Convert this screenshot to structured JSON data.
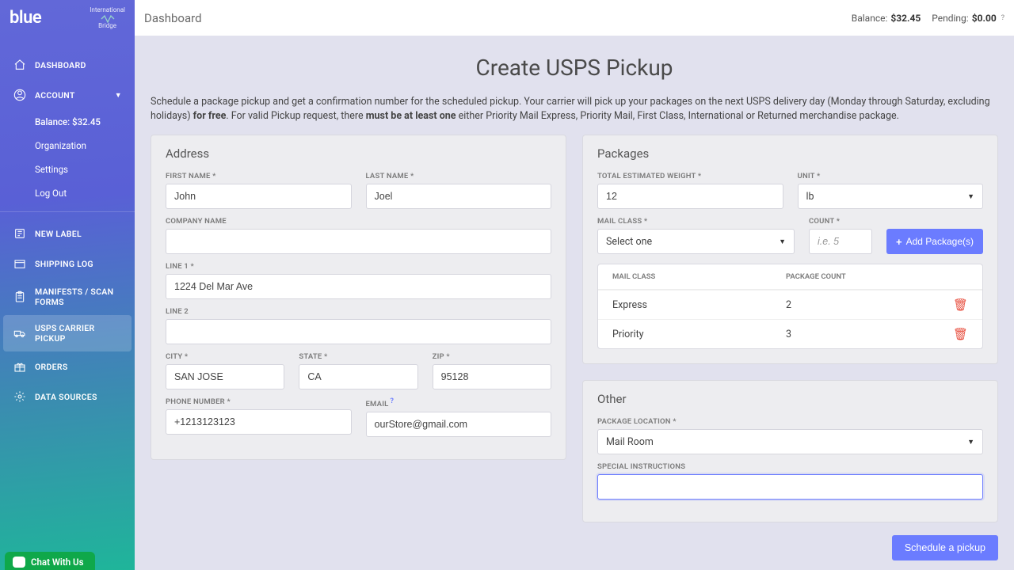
{
  "brand": "blue",
  "brand_badge_top": "International",
  "brand_badge_bottom": "Bridge",
  "topbar": {
    "title": "Dashboard",
    "balance_label": "Balance:",
    "balance_value": "$32.45",
    "pending_label": "Pending:",
    "pending_value": "$0.00"
  },
  "nav": {
    "dashboard": "DASHBOARD",
    "account": "ACCOUNT",
    "balance_label": "Balance:",
    "balance_value": "$32.45",
    "organization": "Organization",
    "settings": "Settings",
    "logout": "Log Out",
    "new_label": "NEW LABEL",
    "shipping_log": "SHIPPING LOG",
    "manifests": "MANIFESTS / SCAN FORMS",
    "usps_pickup": "USPS CARRIER PICKUP",
    "orders": "ORDERS",
    "data_sources": "DATA SOURCES"
  },
  "chat": "Chat With Us",
  "page": {
    "title": "Create USPS Pickup",
    "desc_1": "Schedule a package pickup and get a confirmation number for the scheduled pickup. Your carrier will pick up your packages on the next USPS delivery day (Monday through Saturday, excluding holidays) ",
    "desc_bold1": "for free",
    "desc_2": ". For valid Pickup request, there ",
    "desc_bold2": "must be at least one",
    "desc_3": " either Priority Mail Express, Priority Mail, First Class, International or Returned merchandise package."
  },
  "address": {
    "card_title": "Address",
    "first_name_label": "FIRST NAME *",
    "first_name": "John",
    "last_name_label": "LAST NAME *",
    "last_name": "Joel",
    "company_label": "COMPANY NAME",
    "company": "",
    "line1_label": "LINE 1 *",
    "line1": "1224 Del Mar Ave",
    "line2_label": "LINE 2",
    "line2": "",
    "city_label": "CITY *",
    "city": "SAN JOSE",
    "state_label": "STATE *",
    "state": "CA",
    "zip_label": "ZIP *",
    "zip": "95128",
    "phone_label": "PHONE NUMBER *",
    "phone": "+1213123123",
    "email_label": "EMAIL",
    "email": "ourStore@gmail.com"
  },
  "packages": {
    "card_title": "Packages",
    "weight_label": "TOTAL ESTIMATED WEIGHT *",
    "weight": "12",
    "unit_label": "UNIT *",
    "unit": "lb",
    "mail_class_label": "MAIL CLASS *",
    "mail_class_placeholder": "Select one",
    "count_label": "COUNT *",
    "count_placeholder": "i.e. 5",
    "add_button": "Add Package(s)",
    "table_head_class": "MAIL CLASS",
    "table_head_count": "PACKAGE COUNT",
    "rows": [
      {
        "class": "Express",
        "count": "2"
      },
      {
        "class": "Priority",
        "count": "3"
      }
    ]
  },
  "other": {
    "card_title": "Other",
    "location_label": "PACKAGE LOCATION *",
    "location": "Mail Room",
    "instructions_label": "SPECIAL INSTRUCTIONS",
    "instructions": ""
  },
  "schedule_btn": "Schedule a pickup"
}
